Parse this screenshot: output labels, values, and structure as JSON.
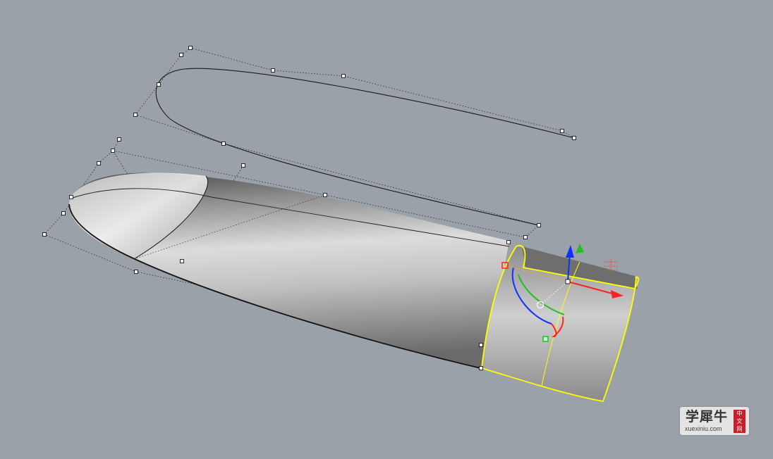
{
  "viewport": {
    "background": "#9aa1a9",
    "selection_color": "#ffff00",
    "gumball_colors": {
      "x_axis": "#ff2020",
      "y_axis": "#20c020",
      "z_axis": "#1030ff"
    },
    "control_point_fill": "#ffffff",
    "curve_color": "#1a1a1a"
  },
  "watermark": {
    "title": "学犀牛",
    "url": "xuexiniu.com",
    "seal": [
      "中",
      "文",
      "网"
    ]
  }
}
